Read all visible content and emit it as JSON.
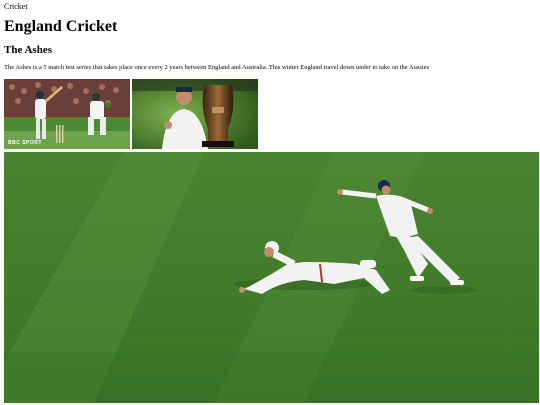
{
  "page": {
    "tab_title": "Cricket",
    "heading": "England Cricket",
    "subheading": "The Ashes",
    "intro": "The Ashes is a 5 match test series that takes place once every 2 years between England and Australia. This winter England travel down under to take on the Aussies"
  },
  "images": {
    "thumb1_watermark": "BBC SPORT"
  },
  "colors": {
    "grass_dark": "#3f7a27",
    "grass_light": "#5f9a3d",
    "kit_white": "#f2f2f2",
    "crowd": "#7a4a3a"
  }
}
